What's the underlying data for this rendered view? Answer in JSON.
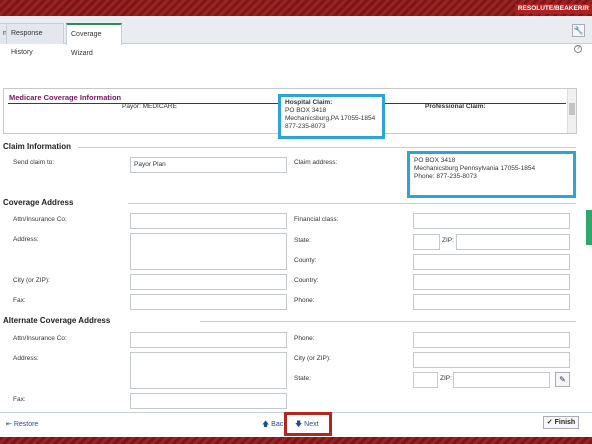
{
  "env_label": "RESOLUTE/BEAKER/R",
  "tabs": [
    {
      "label": "n"
    },
    {
      "label": "Response History"
    },
    {
      "label": "Coverage Wizard"
    }
  ],
  "help_glyph": "?",
  "medicare": {
    "title": "Medicare Coverage Information",
    "payor": "Payor: MEDICARE",
    "hospital_title": "Hospital Claim:",
    "hospital_lines": [
      "PO BOX 3418",
      "Mechanicsburg,PA 17055-1854",
      "877-235-8073"
    ],
    "professional_title": "Professional Claim:"
  },
  "claim_info": {
    "title": "Claim Information",
    "send_label": "Send claim to:",
    "send_value": "Payor Plan",
    "addr_label": "Claim address:",
    "addr_lines": [
      "PO BOX 3418",
      "Mechanicsburg Pennsylvania 17055-1854",
      "Phone: 877-235-8073"
    ]
  },
  "coverage_address": {
    "title": "Coverage Address",
    "attn": "Attn/Insurance Co:",
    "address": "Address:",
    "city": "City (or ZIP):",
    "fax": "Fax:",
    "financial": "Financial class:",
    "state": "State:",
    "zip": "ZIP:",
    "county": "County:",
    "country": "Country:",
    "phone": "Phone:"
  },
  "alt_address": {
    "title": "Alternate Coverage Address",
    "attn": "Attn/Insurance Co:",
    "address": "Address:",
    "fax": "Fax:",
    "phone": "Phone:",
    "city": "City (or ZIP):",
    "state": "State:",
    "zip": "ZIP:"
  },
  "footer": {
    "restore": "Restore",
    "back": "Bac",
    "next": "Next",
    "finish": "Finish"
  },
  "icons": {
    "wrench": "wrench-icon",
    "pencil": "pencil-icon"
  }
}
